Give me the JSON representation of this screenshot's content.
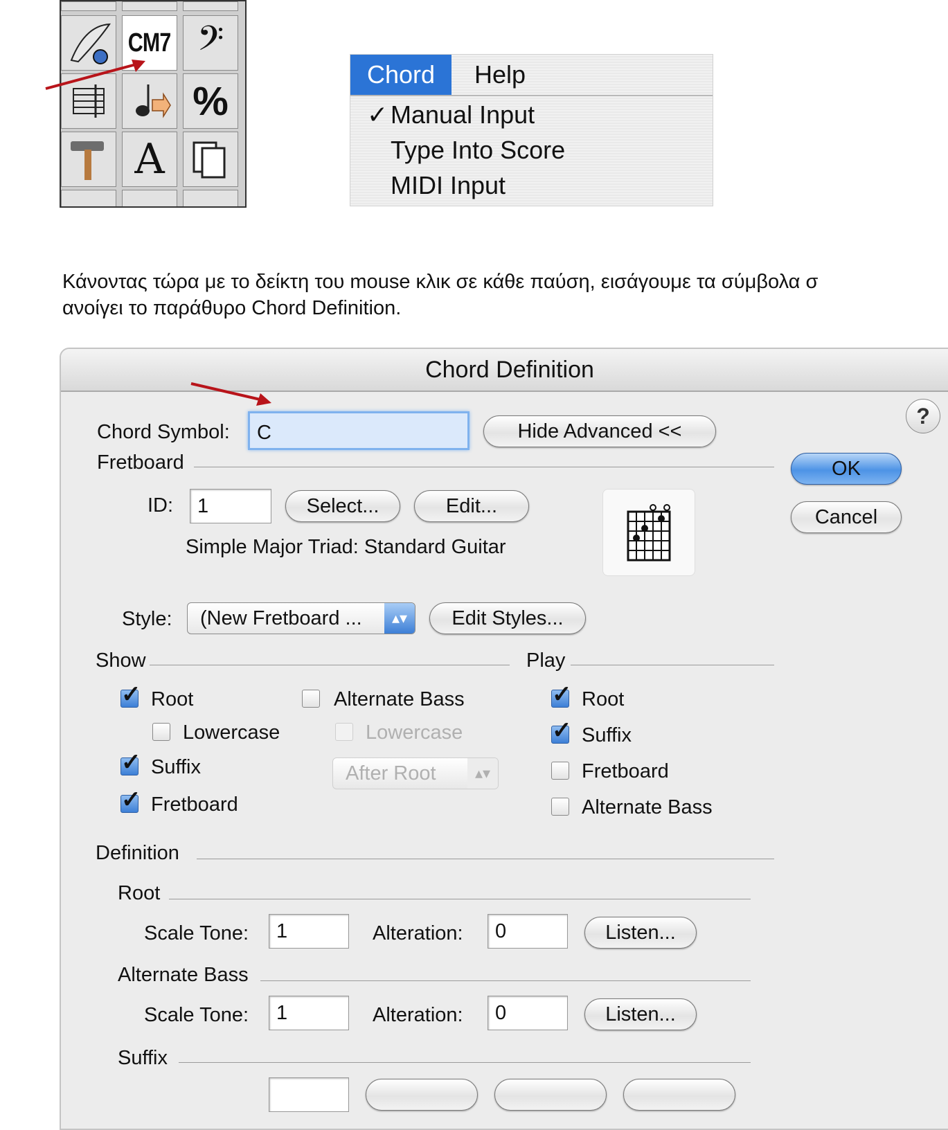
{
  "palette": {
    "cm7_label": "CM7",
    "percent_label": "%",
    "text_tool_label": "A"
  },
  "chord_menu": {
    "menus": [
      "Chord",
      "Help"
    ],
    "items": [
      {
        "label": "Manual Input",
        "checked": "✓"
      },
      {
        "label": "Type Into Score",
        "checked": ""
      },
      {
        "label": "MIDI Input",
        "checked": ""
      }
    ]
  },
  "paragraph": {
    "line1": "Κάνοντας τώρα με το δείκτη του mouse κλικ σε κάθε παύση, εισάγουμε τα σύμβολα σ",
    "line2": "ανοίγει το παράθυρο Chord Definition."
  },
  "dialog": {
    "title": "Chord Definition",
    "chord_symbol_label": "Chord Symbol:",
    "chord_symbol_value": "C",
    "hide_advanced": "Hide Advanced <<",
    "ok": "OK",
    "cancel": "Cancel",
    "help": "?",
    "fretboard_section": "Fretboard",
    "id_label": "ID:",
    "id_value": "1",
    "select_button": "Select...",
    "edit_button": "Edit...",
    "fretboard_desc": "Simple Major Triad:  Standard Guitar",
    "style_label": "Style:",
    "style_value": "(New Fretboard ...",
    "edit_styles_button": "Edit Styles...",
    "show_section": "Show",
    "play_section": "Play",
    "show": {
      "root": "Root",
      "lowercase": "Lowercase",
      "suffix": "Suffix",
      "fretboard": "Fretboard",
      "alternate_bass": "Alternate Bass",
      "alt_lowercase": "Lowercase",
      "after_root": "After Root"
    },
    "play": {
      "root": "Root",
      "suffix": "Suffix",
      "fretboard": "Fretboard",
      "alternate_bass": "Alternate Bass"
    },
    "definition_section": "Definition",
    "root_section": "Root",
    "alt_bass_section": "Alternate Bass",
    "suffix_section": "Suffix",
    "scale_tone_label": "Scale Tone:",
    "alteration_label": "Alteration:",
    "listen_button": "Listen...",
    "root_scale_tone": "1",
    "root_alteration": "0",
    "alt_scale_tone": "1",
    "alt_alteration": "0"
  },
  "colors": {
    "menu_highlight": "#2b74d6",
    "annotation_arrow": "#b8141a",
    "checkbox_checked": "#3d7fd6"
  }
}
